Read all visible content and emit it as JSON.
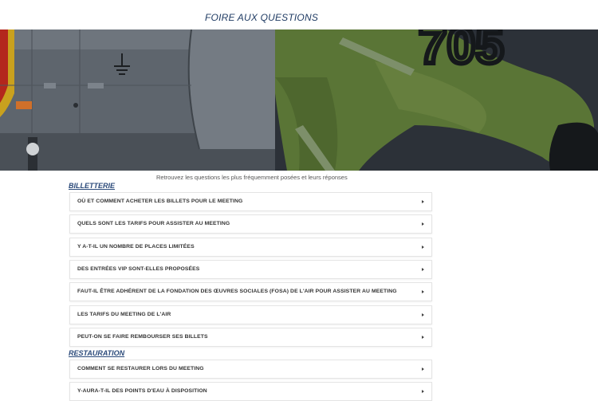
{
  "page": {
    "title": "FOIRE AUX QUESTIONS",
    "intro": "Retrouvez les questions les plus fréquemment posées et leurs réponses"
  },
  "hero": {
    "image_description_icon": "aircraft-and-pilot-photo",
    "tail_number": "705"
  },
  "sections": [
    {
      "heading": "BILLETTERIE",
      "items": [
        {
          "label": "OÙ ET COMMENT ACHETER LES BILLETS POUR LE MEETING"
        },
        {
          "label": "QUELS SONT LES TARIFS POUR ASSISTER AU MEETING"
        },
        {
          "label": "Y A-T-IL UN NOMBRE DE PLACES LIMITÉES"
        },
        {
          "label": "DES ENTRÉES VIP SONT-ELLES PROPOSÉES"
        },
        {
          "label": "FAUT-IL ÊTRE ADHÉRENT DE LA FONDATION DES ŒUVRES SOCIALES (FOSA) DE L'AIR POUR ASSISTER AU MEETING"
        },
        {
          "label": "LES TARIFS DU MEETING DE L'AIR"
        },
        {
          "label": "PEUT-ON SE FAIRE REMBOURSER SES BILLETS"
        }
      ]
    },
    {
      "heading": "RESTAURATION",
      "items": [
        {
          "label": "COMMENT SE RESTAURER LORS DU MEETING"
        },
        {
          "label": "Y-AURA-T-IL DES POINTS D'EAU À DISPOSITION"
        }
      ]
    }
  ],
  "colors": {
    "title": "#1f3b63",
    "heading": "#2b4a7a",
    "fuselage": "#5d636b",
    "flightsuit": "#4f6b2e"
  }
}
